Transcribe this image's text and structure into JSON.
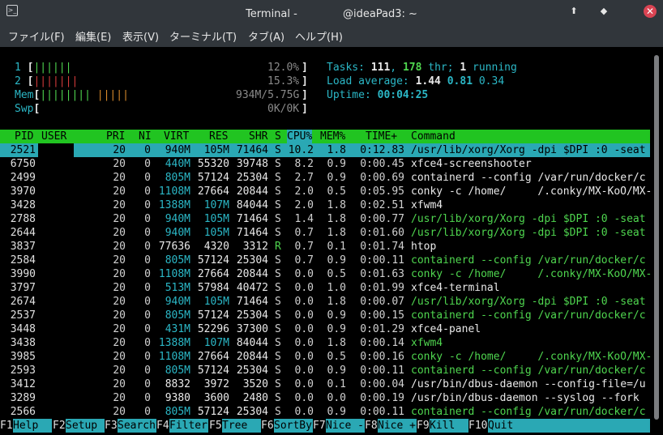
{
  "window": {
    "title": "Terminal - 　　　　@ideaPad3: ~",
    "buttons": {
      "minimize": "⬆",
      "maximize": "◆",
      "close": "✕"
    }
  },
  "menu": [
    "ファイル(F)",
    "編集(E)",
    "表示(V)",
    "ターミナル(T)",
    "タブ(A)",
    "ヘルプ(H)"
  ],
  "meters": {
    "cpu1": {
      "label": "1",
      "bars": "||||||",
      "value": "12.0%"
    },
    "cpu2": {
      "label": "2",
      "bars": "|||||||",
      "value": "15.3%"
    },
    "mem": {
      "label": "Mem",
      "bars_green": "||||||||",
      "bars_orange": "|||||",
      "value": "934M/5.75G"
    },
    "swp": {
      "label": "Swp",
      "value": "0K/0K"
    }
  },
  "stats": {
    "tasks_label": "Tasks: ",
    "tasks": "111",
    "thr": "178",
    "thr_label": " thr; ",
    "running": "1",
    "running_label": " running",
    "load_label": "Load average: ",
    "load1": "1.44",
    "load5": "0.81",
    "load15": "0.34",
    "uptime_label": "Uptime: ",
    "uptime": "00:04:25"
  },
  "columns": [
    "PID",
    "USER",
    "PRI",
    "NI",
    "VIRT",
    "RES",
    "SHR",
    "S",
    "CPU%",
    "MEM%",
    "TIME+",
    "Command"
  ],
  "processes": [
    {
      "pid": "2521",
      "pri": "20",
      "ni": "0",
      "virt": "940M",
      "res": "105M",
      "shr": "71464",
      "s": "S",
      "cpu": "10.2",
      "mem": "1.8",
      "time": "0:12.83",
      "cmd": "/usr/lib/xorg/Xorg -dpi $DPI :0 -seat",
      "thread": false,
      "selected": true
    },
    {
      "pid": "6750",
      "pri": "20",
      "ni": "0",
      "virt": "440M",
      "res": "55320",
      "shr": "39748",
      "s": "S",
      "cpu": "8.2",
      "mem": "0.9",
      "time": "0:00.45",
      "cmd": "xfce4-screenshooter",
      "thread": false
    },
    {
      "pid": "2499",
      "pri": "20",
      "ni": "0",
      "virt": "805M",
      "res": "57124",
      "shr": "25304",
      "s": "S",
      "cpu": "2.7",
      "mem": "0.9",
      "time": "0:00.69",
      "cmd": "containerd --config /var/run/docker/c",
      "thread": false
    },
    {
      "pid": "3970",
      "pri": "20",
      "ni": "0",
      "virt": "1108M",
      "res": "27664",
      "shr": "20844",
      "s": "S",
      "cpu": "2.0",
      "mem": "0.5",
      "time": "0:05.95",
      "cmd": "conky -c /home/　　　/.conky/MX-KoO/MX-",
      "thread": false
    },
    {
      "pid": "3428",
      "pri": "20",
      "ni": "0",
      "virt": "1388M",
      "res": "107M",
      "shr": "84044",
      "s": "S",
      "cpu": "2.0",
      "mem": "1.8",
      "time": "0:02.51",
      "cmd": "xfwm4",
      "thread": false
    },
    {
      "pid": "2788",
      "pri": "20",
      "ni": "0",
      "virt": "940M",
      "res": "105M",
      "shr": "71464",
      "s": "S",
      "cpu": "1.4",
      "mem": "1.8",
      "time": "0:00.77",
      "cmd": "/usr/lib/xorg/Xorg -dpi $DPI :0 -seat",
      "thread": true
    },
    {
      "pid": "2644",
      "pri": "20",
      "ni": "0",
      "virt": "940M",
      "res": "105M",
      "shr": "71464",
      "s": "S",
      "cpu": "0.7",
      "mem": "1.8",
      "time": "0:01.60",
      "cmd": "/usr/lib/xorg/Xorg -dpi $DPI :0 -seat",
      "thread": true
    },
    {
      "pid": "3837",
      "pri": "20",
      "ni": "0",
      "virt": "77636",
      "res": "4320",
      "shr": "3312",
      "s": "R",
      "cpu": "0.7",
      "mem": "0.1",
      "time": "0:01.74",
      "cmd": "htop",
      "thread": false
    },
    {
      "pid": "2584",
      "pri": "20",
      "ni": "0",
      "virt": "805M",
      "res": "57124",
      "shr": "25304",
      "s": "S",
      "cpu": "0.7",
      "mem": "0.9",
      "time": "0:00.11",
      "cmd": "containerd --config /var/run/docker/c",
      "thread": true
    },
    {
      "pid": "3990",
      "pri": "20",
      "ni": "0",
      "virt": "1108M",
      "res": "27664",
      "shr": "20844",
      "s": "S",
      "cpu": "0.0",
      "mem": "0.5",
      "time": "0:01.63",
      "cmd": "conky -c /home/　　　/.conky/MX-KoO/MX-",
      "thread": true
    },
    {
      "pid": "3797",
      "pri": "20",
      "ni": "0",
      "virt": "513M",
      "res": "57984",
      "shr": "40472",
      "s": "S",
      "cpu": "0.0",
      "mem": "1.0",
      "time": "0:01.99",
      "cmd": "xfce4-terminal",
      "thread": false
    },
    {
      "pid": "2674",
      "pri": "20",
      "ni": "0",
      "virt": "940M",
      "res": "105M",
      "shr": "71464",
      "s": "S",
      "cpu": "0.0",
      "mem": "1.8",
      "time": "0:00.07",
      "cmd": "/usr/lib/xorg/Xorg -dpi $DPI :0 -seat",
      "thread": true
    },
    {
      "pid": "2537",
      "pri": "20",
      "ni": "0",
      "virt": "805M",
      "res": "57124",
      "shr": "25304",
      "s": "S",
      "cpu": "0.0",
      "mem": "0.9",
      "time": "0:00.15",
      "cmd": "containerd --config /var/run/docker/c",
      "thread": true
    },
    {
      "pid": "3448",
      "pri": "20",
      "ni": "0",
      "virt": "431M",
      "res": "52296",
      "shr": "37300",
      "s": "S",
      "cpu": "0.0",
      "mem": "0.9",
      "time": "0:01.29",
      "cmd": "xfce4-panel",
      "thread": false
    },
    {
      "pid": "3438",
      "pri": "20",
      "ni": "0",
      "virt": "1388M",
      "res": "107M",
      "shr": "84044",
      "s": "S",
      "cpu": "0.0",
      "mem": "1.8",
      "time": "0:00.14",
      "cmd": "xfwm4",
      "thread": true
    },
    {
      "pid": "3985",
      "pri": "20",
      "ni": "0",
      "virt": "1108M",
      "res": "27664",
      "shr": "20844",
      "s": "S",
      "cpu": "0.0",
      "mem": "0.5",
      "time": "0:00.16",
      "cmd": "conky -c /home/　　　/.conky/MX-KoO/MX-",
      "thread": true
    },
    {
      "pid": "2593",
      "pri": "20",
      "ni": "0",
      "virt": "805M",
      "res": "57124",
      "shr": "25304",
      "s": "S",
      "cpu": "0.0",
      "mem": "0.9",
      "time": "0:00.11",
      "cmd": "containerd --config /var/run/docker/c",
      "thread": true
    },
    {
      "pid": "3412",
      "pri": "20",
      "ni": "0",
      "virt": "8832",
      "res": "3972",
      "shr": "3520",
      "s": "S",
      "cpu": "0.0",
      "mem": "0.1",
      "time": "0:00.04",
      "cmd": "/usr/bin/dbus-daemon --config-file=/u",
      "thread": false
    },
    {
      "pid": "3289",
      "pri": "20",
      "ni": "0",
      "virt": "9380",
      "res": "3600",
      "shr": "2480",
      "s": "S",
      "cpu": "0.0",
      "mem": "0.0",
      "time": "0:00.19",
      "cmd": "/usr/bin/dbus-daemon --syslog --fork",
      "thread": false
    },
    {
      "pid": "2566",
      "pri": "20",
      "ni": "0",
      "virt": "805M",
      "res": "57124",
      "shr": "25304",
      "s": "S",
      "cpu": "0.0",
      "mem": "0.9",
      "time": "0:00.11",
      "cmd": "containerd --config /var/run/docker/c",
      "thread": true
    }
  ],
  "fkeys": [
    {
      "key": "F1",
      "label": "Help  "
    },
    {
      "key": "F2",
      "label": "Setup "
    },
    {
      "key": "F3",
      "label": "Search"
    },
    {
      "key": "F4",
      "label": "Filter"
    },
    {
      "key": "F5",
      "label": "Tree  "
    },
    {
      "key": "F6",
      "label": "SortBy"
    },
    {
      "key": "F7",
      "label": "Nice -"
    },
    {
      "key": "F8",
      "label": "Nice +"
    },
    {
      "key": "F9",
      "label": "Kill  "
    },
    {
      "key": "F10",
      "label": "Quit"
    }
  ],
  "colors": {
    "header_bg": "#21c421",
    "selected_bg": "#2aa8b4",
    "thread_green": "#4fd64f",
    "titlebar": "#31363b"
  }
}
